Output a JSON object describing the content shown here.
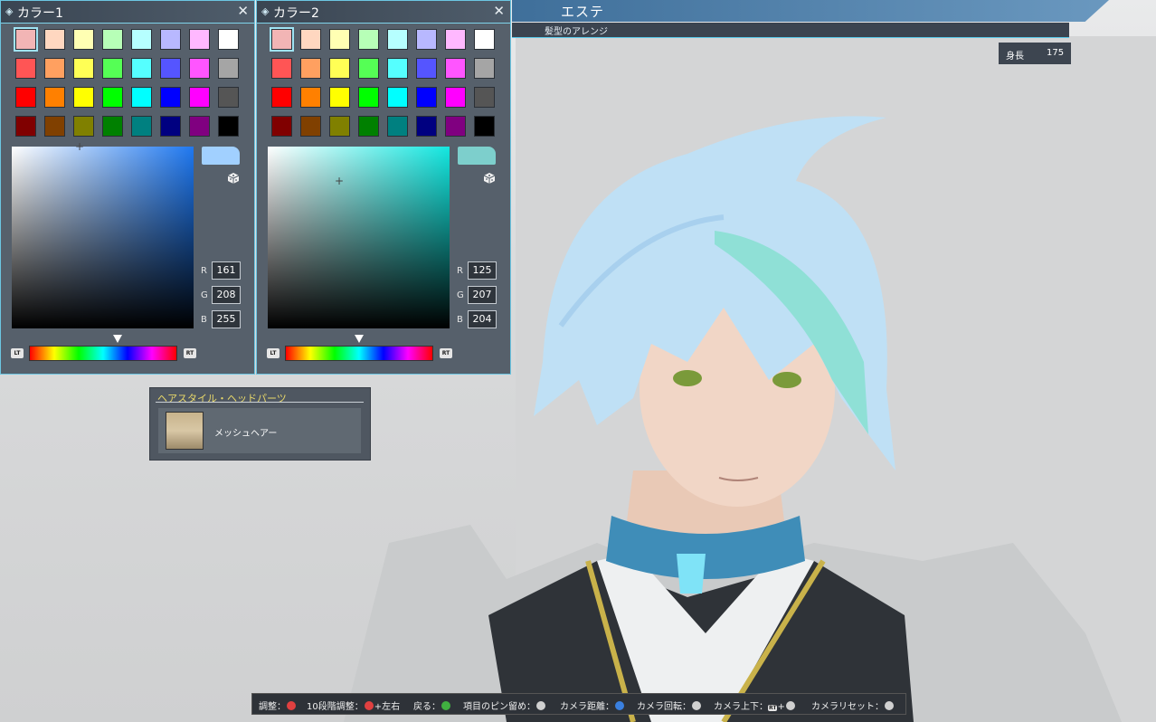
{
  "header": {
    "title": "エステ",
    "subtitle": "髪型のアレンジ"
  },
  "height": {
    "label": "身長",
    "value": "175"
  },
  "panels": [
    {
      "title": "カラー1",
      "close": "✕",
      "selected_color": "#a1d0ff",
      "picker_hue": "#1f78f0",
      "cursor_pos": "top-center",
      "r_label": "R",
      "g_label": "G",
      "b_label": "B",
      "r": "161",
      "g": "208",
      "b": "255",
      "hue_fraction": 0.6
    },
    {
      "title": "カラー2",
      "close": "✕",
      "selected_color": "#7dcfcc",
      "picker_hue": "#13e7e0",
      "cursor_pos": "upper-left",
      "r_label": "R",
      "g_label": "G",
      "b_label": "B",
      "r": "125",
      "g": "207",
      "b": "204",
      "hue_fraction": 0.5
    }
  ],
  "swatches": [
    "#f2b5b5",
    "#ffd7c0",
    "#ffffb3",
    "#b7ffb7",
    "#b6ffff",
    "#b8b8ff",
    "#ffb8ff",
    "#ffffff",
    "#ff5555",
    "#ffa060",
    "#ffff55",
    "#55ff55",
    "#55ffff",
    "#5555ff",
    "#ff55ff",
    "#a5a5a5",
    "#ff0000",
    "#ff8000",
    "#ffff00",
    "#00ff00",
    "#00ffff",
    "#0000ff",
    "#ff00ff",
    "#555555",
    "#800000",
    "#804000",
    "#808000",
    "#008000",
    "#008080",
    "#000080",
    "#800080",
    "#000000"
  ],
  "button_tags": {
    "left": "LT",
    "right": "RT"
  },
  "hairstyle": {
    "title": "ヘアスタイル・ヘッドパーツ",
    "item": "メッシュヘアー"
  },
  "help": [
    {
      "text": "調整：",
      "btn": "#e04040"
    },
    {
      "text": "10段階調整：",
      "btn": "#e04040",
      "suffix": "+左右"
    },
    {
      "text": "戻る：",
      "btn": "#40b040"
    },
    {
      "text": "項目のピン留め：",
      "btn": "#d0d0d0"
    },
    {
      "text": "カメラ距離：",
      "btn": "#3a80e0"
    },
    {
      "text": "カメラ回転：",
      "btn": "#d0d0d0"
    },
    {
      "text": "カメラ上下：",
      "btn": "#d0d0d0",
      "prefix_tag": "RT",
      "suffix": "+"
    },
    {
      "text": "カメラリセット：",
      "btn": "#d0d0d0"
    }
  ]
}
